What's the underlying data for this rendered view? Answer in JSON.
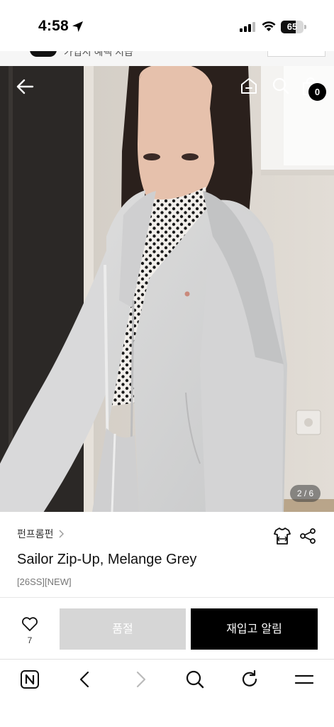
{
  "status_bar": {
    "time": "4:58",
    "battery_level": "65",
    "battery_fraction": 0.65
  },
  "peek": {
    "text": "가입시 혜택 지급"
  },
  "hero": {
    "page_indicator": "2 / 6",
    "cart_count": "0"
  },
  "product": {
    "brand": "펀프롬펀",
    "title": "Sailor Zip-Up, Melange Grey",
    "tags": "[26SS][NEW]"
  },
  "actions": {
    "like_count": "7",
    "soldout_label": "품절",
    "restock_label": "재입고 알림"
  },
  "icons": {
    "back": "arrow-left-icon",
    "home": "home-icon",
    "search": "search-icon",
    "bag": "shopping-bag-icon",
    "size": "size-guide-icon",
    "share": "share-icon",
    "like": "heart-icon",
    "browser_n": "n-logo-icon",
    "browser_back": "chevron-left-icon",
    "browser_forward": "chevron-right-icon",
    "browser_search": "search-icon",
    "browser_reload": "reload-icon",
    "browser_menu": "menu-icon"
  },
  "colors": {
    "primary_button": "#000000",
    "disabled_button": "#d6d6d6"
  }
}
